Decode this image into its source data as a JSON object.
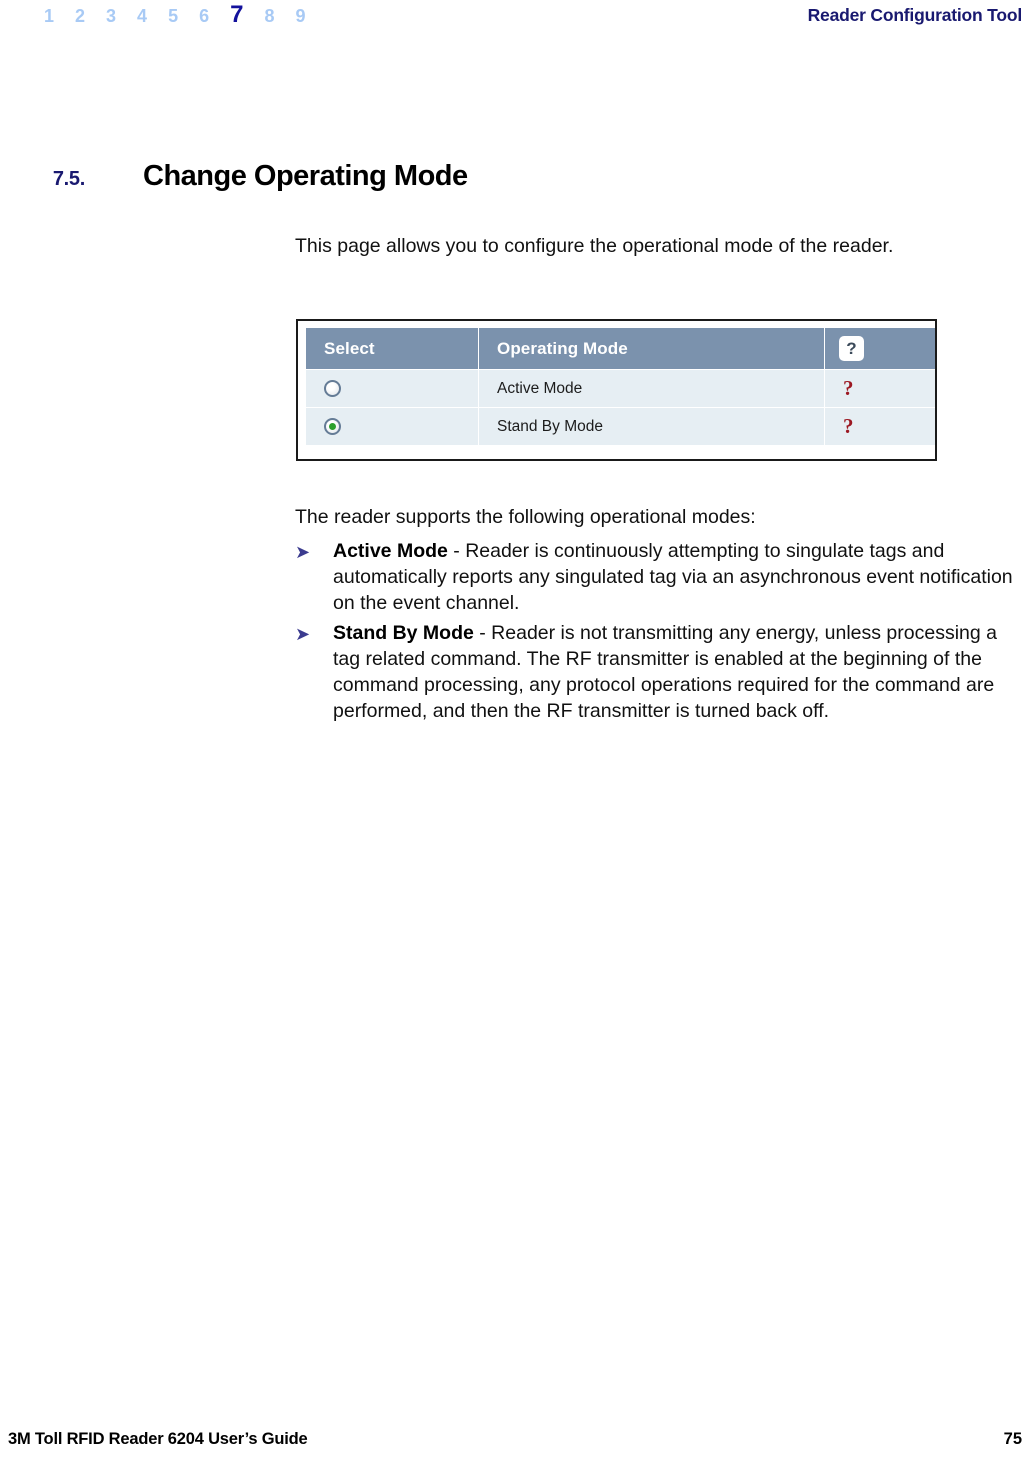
{
  "header": {
    "chapter_numbers": [
      "1",
      "2",
      "3",
      "4",
      "5",
      "6",
      "7",
      "8",
      "9"
    ],
    "current_chapter": "7",
    "title": "Reader Configuration Tool",
    "nav_color": "#a8caf5",
    "nav_active_color": "#13119c",
    "title_color": "#191970"
  },
  "section": {
    "number": "7.5.",
    "title": "Change Operating Mode",
    "number_color": "#191970"
  },
  "body": {
    "intro": "This page allows you to configure the operational mode of the reader.",
    "supports": "The reader supports the following operational modes:"
  },
  "figure": {
    "columns": [
      "Select",
      "Operating Mode",
      "?"
    ],
    "header_bg": "#7b92ad",
    "row_bg": "#e6eef3",
    "help_icon_color": "#9c1822",
    "radio_selected_color": "#2ca02c",
    "help_header_label": "?",
    "rows": [
      {
        "selected": false,
        "radio_state": "unselected",
        "mode": "Active Mode",
        "help": "?"
      },
      {
        "selected": true,
        "radio_state": "selected",
        "mode": "Stand By Mode",
        "help": "?"
      }
    ]
  },
  "bullets": {
    "marker": "➤",
    "marker_color": "#3b3b8f",
    "items": [
      {
        "term": "Active Mode",
        "text": " - Reader is continuously attempting to singulate tags and automatically reports any singulated tag via an asynchronous event notification on the event channel."
      },
      {
        "term": "Stand By Mode",
        "text": " - Reader is not transmitting any energy, unless processing a tag related command. The RF transmitter is enabled at the beginning of the command processing, any protocol operations required for the command are performed, and then the RF transmitter is turned back off."
      }
    ]
  },
  "footer": {
    "left": "3M Toll RFID Reader 6204 User’s Guide",
    "page_number": "75"
  }
}
